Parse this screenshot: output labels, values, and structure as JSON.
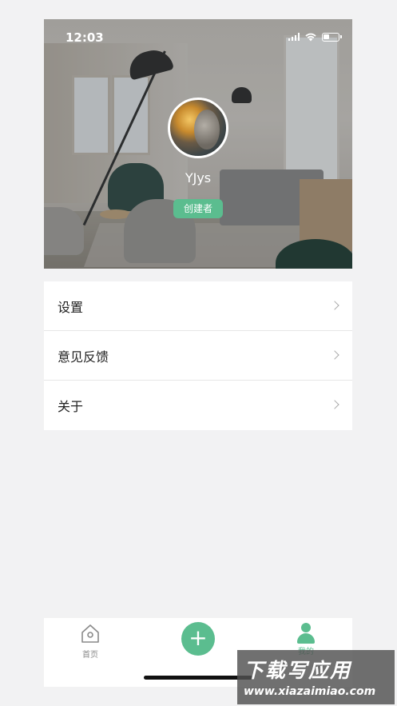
{
  "status_bar": {
    "time": "12:03"
  },
  "profile": {
    "username": "YJys",
    "role_badge": "创建者"
  },
  "menu": {
    "items": [
      {
        "label": "设置"
      },
      {
        "label": "意见反馈"
      },
      {
        "label": "关于"
      }
    ]
  },
  "tab_bar": {
    "items": [
      {
        "label": "首页",
        "icon": "home-icon",
        "active": false
      },
      {
        "label": "+",
        "icon": "add-icon",
        "active": false
      },
      {
        "label": "我的",
        "icon": "person-icon",
        "active": true
      }
    ]
  },
  "watermark": {
    "title": "下载写应用",
    "url": "www.xiazaimiao.com"
  },
  "colors": {
    "accent": "#5bbd8f",
    "background": "#f2f2f3",
    "text": "#222222"
  }
}
